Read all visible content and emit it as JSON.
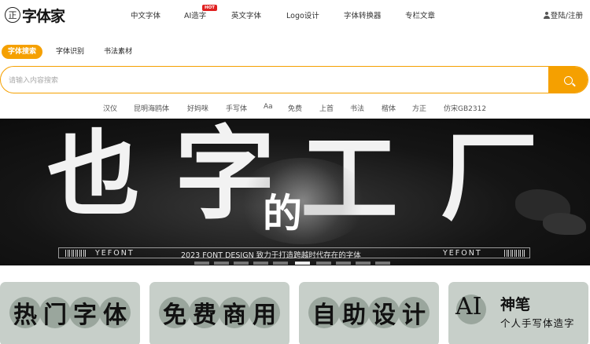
{
  "header": {
    "logo_badge": "正",
    "logo_text": "字体家",
    "nav": [
      "中文字体",
      "AI造字",
      "英文字体",
      "Logo设计",
      "字体转换器",
      "专栏文章"
    ],
    "hot_badge": "HOT",
    "login": "登陆/注册"
  },
  "search": {
    "tabs": [
      "字体搜索",
      "字体识别",
      "书法素材"
    ],
    "placeholder": "请输入内容搜索",
    "quick_tags": [
      "汉仪",
      "昆明海鸥体",
      "好妈咪",
      "手写体",
      "Aa",
      "免费",
      "上首",
      "书法",
      "楷体",
      "方正",
      "仿宋GB2312"
    ]
  },
  "banner": {
    "big_chars": [
      "也",
      "字",
      "工",
      "厂"
    ],
    "small_char": "的",
    "strip_left": "YEFONT",
    "strip_middle": "2023  FONT DESIGN   致力于打造跨越时代存在的字体",
    "strip_right": "YEFONT",
    "slide_count": 10,
    "active_slide": 5
  },
  "cards": [
    {
      "chars": [
        "热",
        "门",
        "字",
        "体"
      ]
    },
    {
      "chars": [
        "免",
        "费",
        "商",
        "用"
      ]
    },
    {
      "chars": [
        "自",
        "助",
        "设",
        "计"
      ]
    },
    {
      "ai": "AI",
      "title": "神笔",
      "subtitle": "个人手写体造字"
    }
  ]
}
